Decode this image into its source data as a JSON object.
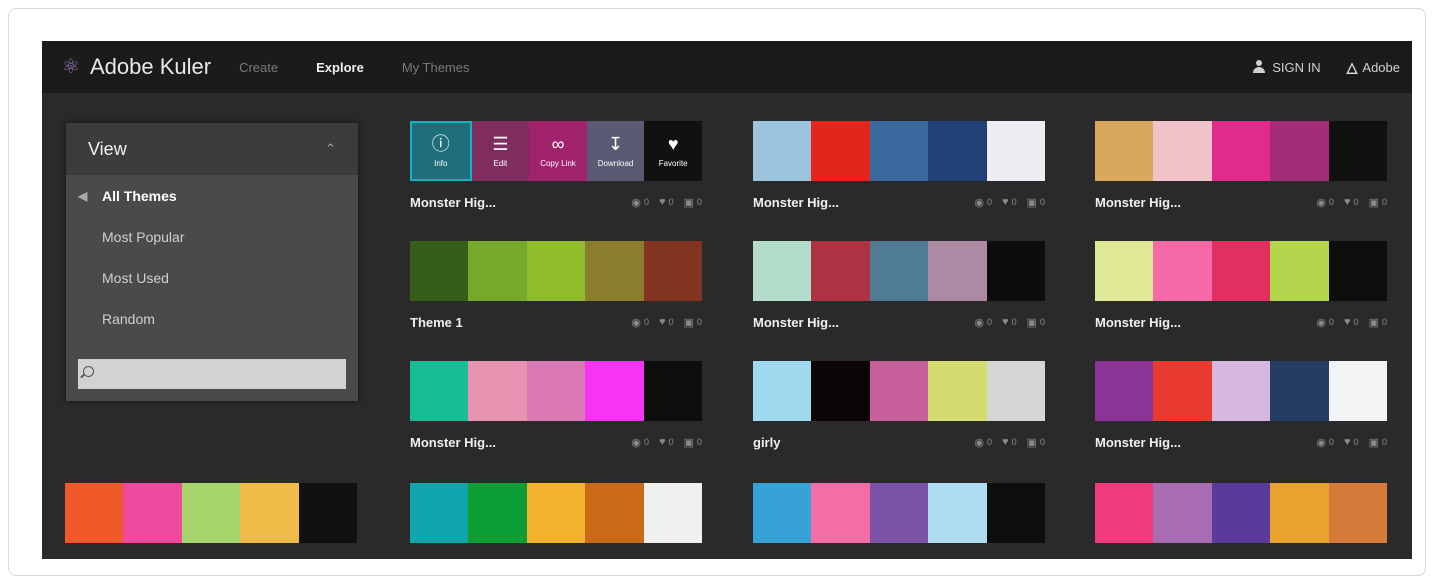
{
  "header": {
    "app_title": "Adobe Kuler",
    "nav": [
      "Create",
      "Explore",
      "My Themes"
    ],
    "sign_in": "SIGN IN",
    "adobe": "Adobe"
  },
  "sidebar": {
    "title": "View",
    "items": [
      "All Themes",
      "Most Popular",
      "Most Used",
      "Random"
    ],
    "search_placeholder": ""
  },
  "toolbar": {
    "info": "Info",
    "edit": "Edit",
    "copy_link": "Copy Link",
    "download": "Download",
    "favorite": "Favorite"
  },
  "themes": [
    {
      "title": "Monster Hig...",
      "views": "0",
      "likes": "0",
      "comments": "0",
      "colors": [
        "#1e6f7a",
        "#7e2d5e",
        "#a0226a",
        "#5a5a72",
        "#111111"
      ]
    },
    {
      "title": "Monster Hig...",
      "views": "0",
      "likes": "0",
      "comments": "0",
      "colors": [
        "#9cc4dc",
        "#e3251b",
        "#3a6a9e",
        "#233f78",
        "#eeeef2"
      ]
    },
    {
      "title": "Monster Hig...",
      "views": "0",
      "likes": "0",
      "comments": "0",
      "colors": [
        "#d9a85c",
        "#efc3c9",
        "#e02b8a",
        "#a22c76",
        "#111111"
      ]
    },
    {
      "title": "Theme 1",
      "views": "0",
      "likes": "0",
      "comments": "0",
      "colors": [
        "#355e18",
        "#76a82a",
        "#8fbc2b",
        "#8a7e2c",
        "#823420"
      ]
    },
    {
      "title": "Monster Hig...",
      "views": "0",
      "likes": "0",
      "comments": "0",
      "colors": [
        "#b3dccb",
        "#ae3342",
        "#4f7b93",
        "#ad8aa4",
        "#0d0d0d"
      ]
    },
    {
      "title": "Monster Hig...",
      "views": "0",
      "likes": "0",
      "comments": "0",
      "colors": [
        "#dfe896",
        "#f56aa7",
        "#e12f62",
        "#b3d64d",
        "#0e0e0e"
      ]
    },
    {
      "title": "Monster Hig...",
      "views": "0",
      "likes": "0",
      "comments": "0",
      "colors": [
        "#18bd96",
        "#e694b2",
        "#db79b4",
        "#f733f4",
        "#0e0e0e"
      ]
    },
    {
      "title": "girly",
      "views": "0",
      "likes": "0",
      "comments": "0",
      "colors": [
        "#9ed9ee",
        "#0a0606",
        "#c7609a",
        "#d4dc70",
        "#d3d6d2"
      ]
    },
    {
      "title": "Monster Hig...",
      "views": "0",
      "likes": "0",
      "comments": "0",
      "colors": [
        "#8c3496",
        "#e83a2e",
        "#d6b8df",
        "#253d63",
        "#f1f3f4"
      ]
    },
    {
      "title": "",
      "views": "",
      "likes": "",
      "comments": "",
      "colors": [
        "#f05a2a",
        "#f04a9e",
        "#a8d46e",
        "#f0bc48",
        "#111111"
      ]
    },
    {
      "title": "",
      "views": "",
      "likes": "",
      "comments": "",
      "colors": [
        "#0ea6ac",
        "#0a9e34",
        "#f2b32c",
        "#c86a18",
        "#f0f0f0"
      ]
    },
    {
      "title": "",
      "views": "",
      "likes": "",
      "comments": "",
      "colors": [
        "#36a2d6",
        "#f36ea6",
        "#7a52a6",
        "#b0dcf2",
        "#0e0e0e"
      ]
    },
    {
      "title": "",
      "views": "",
      "likes": "",
      "comments": "",
      "colors": [
        "#f03a7e",
        "#a86cb2",
        "#5a3a9a",
        "#e8a22e",
        "#d67a3a"
      ]
    }
  ]
}
